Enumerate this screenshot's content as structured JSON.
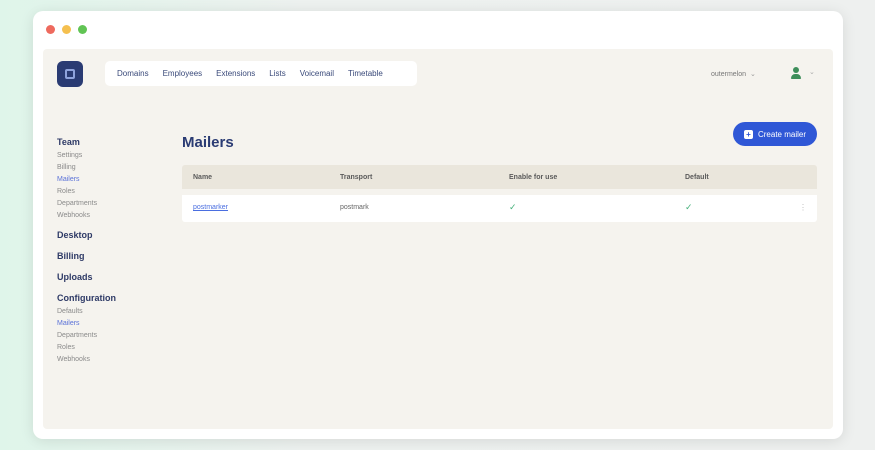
{
  "window": {
    "controls": [
      "close",
      "minimize",
      "maximize"
    ]
  },
  "topnav": {
    "items": [
      "Domains",
      "Employees",
      "Extensions",
      "Lists",
      "Voicemail",
      "Timetable"
    ]
  },
  "user_select": {
    "value": "outermelon"
  },
  "sidebar": {
    "groups": [
      {
        "title": "Team",
        "items": [
          {
            "label": "Settings",
            "active": false
          },
          {
            "label": "Billing",
            "active": false
          },
          {
            "label": "Mailers",
            "active": true
          },
          {
            "label": "Roles",
            "active": false
          },
          {
            "label": "Departments",
            "active": false
          },
          {
            "label": "Webhooks",
            "active": false
          }
        ]
      },
      {
        "title": "Desktop",
        "items": []
      },
      {
        "title": "Billing",
        "items": []
      },
      {
        "title": "Uploads",
        "items": []
      },
      {
        "title": "Configuration",
        "items": [
          {
            "label": "Defaults",
            "active": false
          },
          {
            "label": "Mailers",
            "active": true
          },
          {
            "label": "Departments",
            "active": false
          },
          {
            "label": "Roles",
            "active": false
          },
          {
            "label": "Webhooks",
            "active": false
          }
        ]
      }
    ]
  },
  "main": {
    "title": "Mailers",
    "create_button": "Create mailer"
  },
  "table": {
    "columns": [
      "Name",
      "Transport",
      "Enable for use",
      "Default"
    ],
    "rows": [
      {
        "name": "postmarker",
        "transport": "postmark",
        "enabled": true,
        "default": true
      }
    ]
  },
  "colors": {
    "accent": "#2f57d6",
    "brand": "#2a3b73",
    "status_ok": "#45b07a"
  },
  "icons": {
    "check": "check-icon",
    "plus": "plus-icon",
    "user": "user-status-icon"
  }
}
